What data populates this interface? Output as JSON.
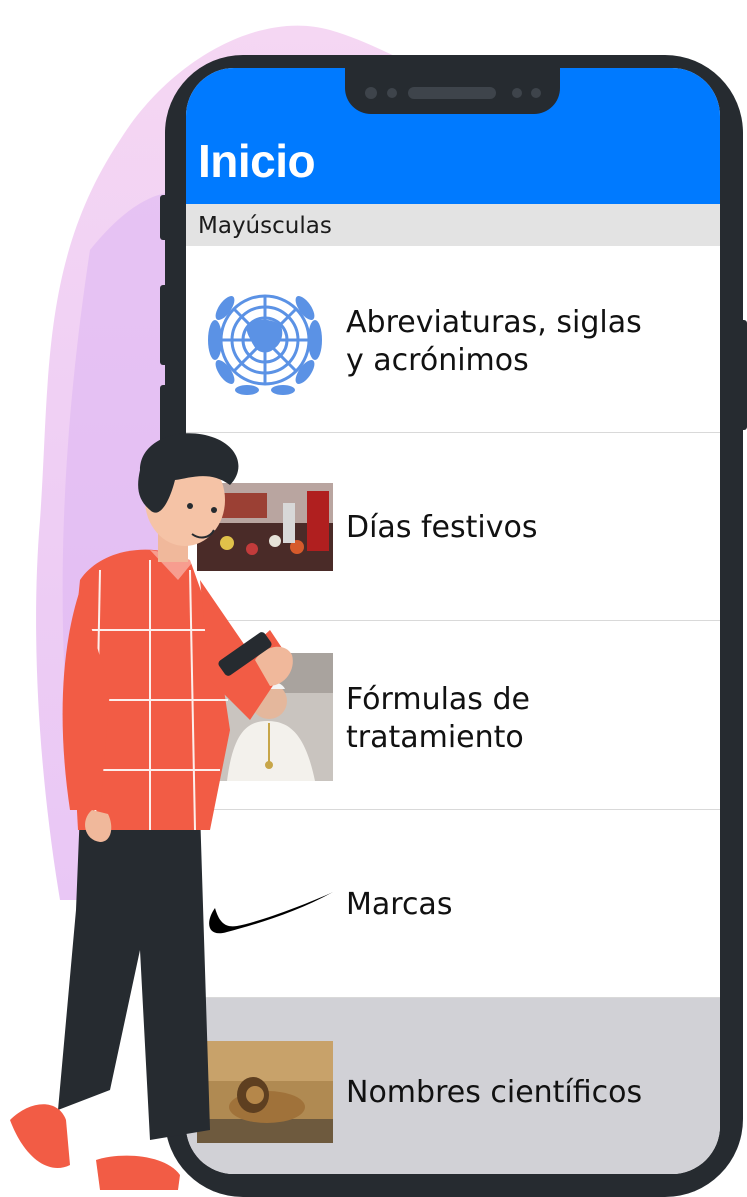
{
  "nav": {
    "title": "Inicio"
  },
  "section": {
    "title": "Mayúsculas"
  },
  "rows": [
    {
      "label_line1": "Abreviaturas, siglas",
      "label_line2": "y acrónimos",
      "icon": "un-emblem-icon"
    },
    {
      "label_line1": "Días festivos",
      "icon": "festival-photo"
    },
    {
      "label_line1": "Fórmulas de",
      "label_line2": "tratamiento",
      "icon": "pope-photo"
    },
    {
      "label_line1": "Marcas",
      "icon": "swoosh-logo-icon"
    },
    {
      "label_line1": "Nombres científicos",
      "icon": "lion-photo",
      "selected": true
    }
  ],
  "colors": {
    "accent": "#007aff",
    "section_bg": "#e3e3e3",
    "selected_bg": "#d1d1d6",
    "phone_frame": "#262b30"
  }
}
